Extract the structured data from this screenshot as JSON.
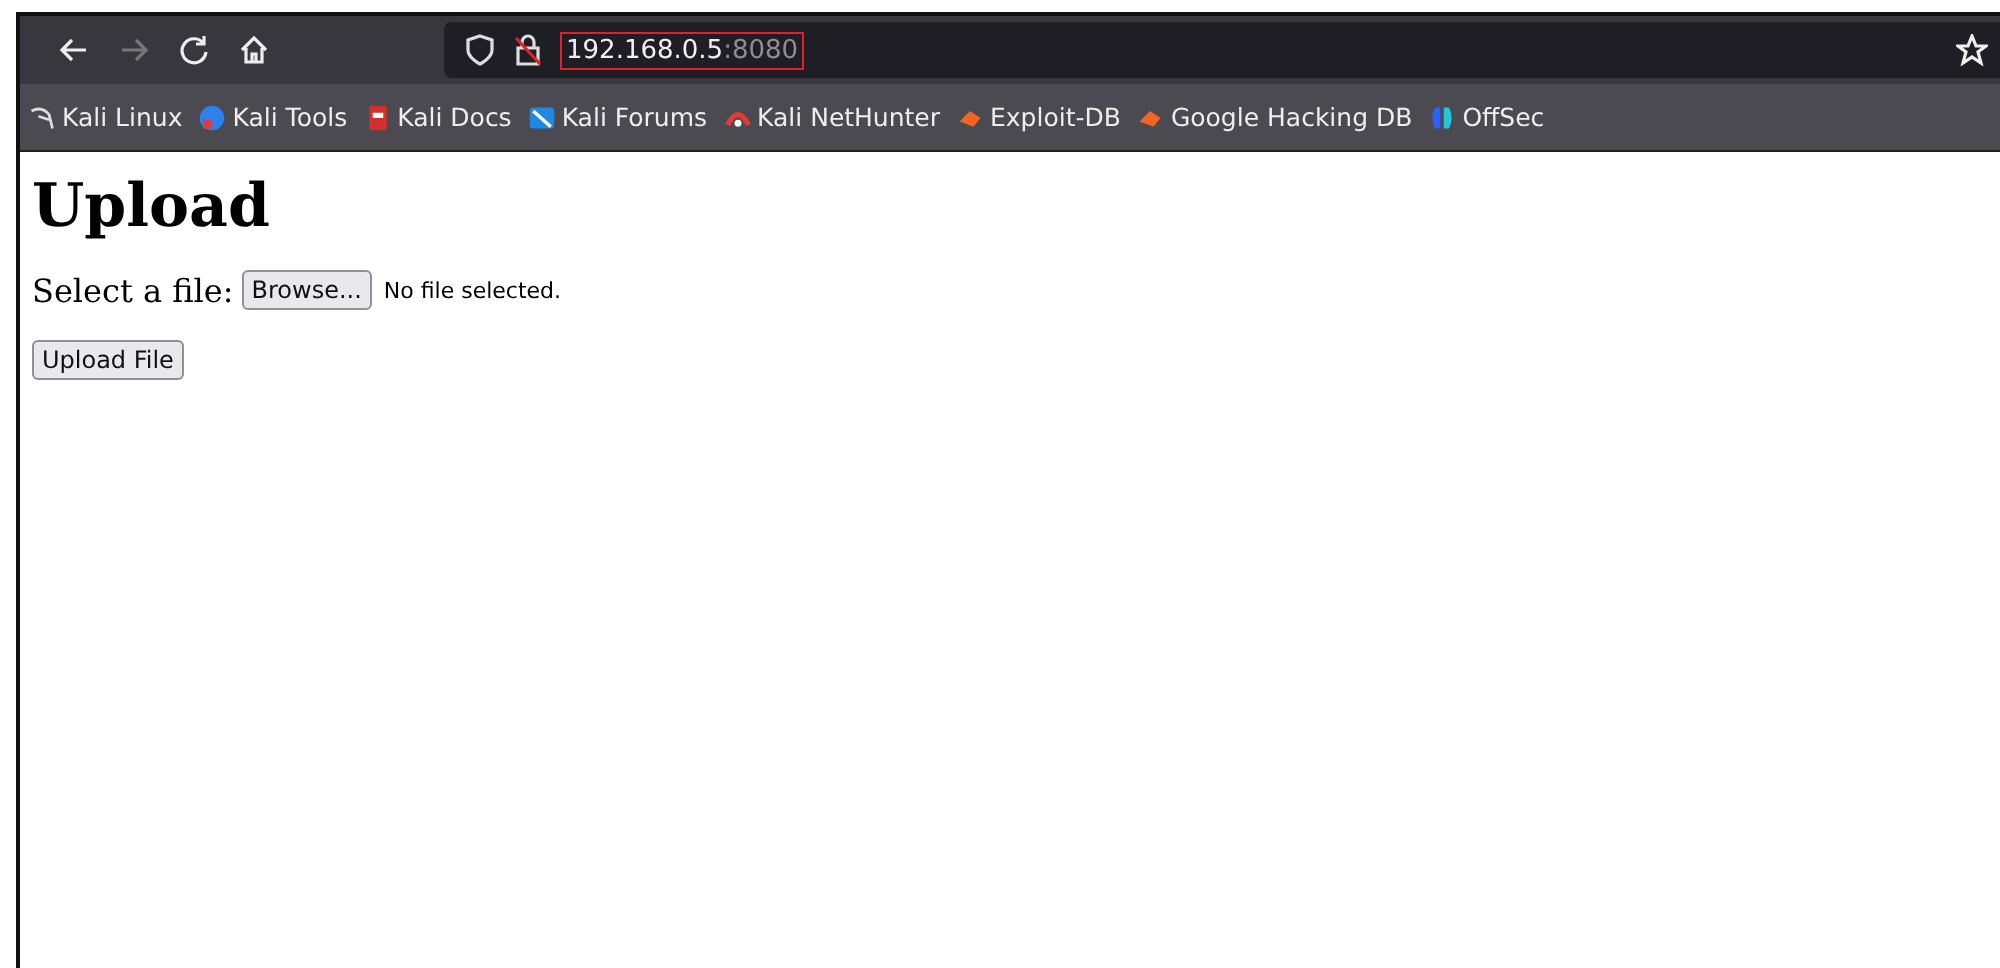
{
  "toolbar": {
    "url_host": "192.168.0.5",
    "url_port": ":8080"
  },
  "bookmarks": [
    {
      "label": "Kali Linux"
    },
    {
      "label": "Kali Tools"
    },
    {
      "label": "Kali Docs"
    },
    {
      "label": "Kali Forums"
    },
    {
      "label": "Kali NetHunter"
    },
    {
      "label": "Exploit-DB"
    },
    {
      "label": "Google Hacking DB"
    },
    {
      "label": "OffSec"
    }
  ],
  "page": {
    "heading": "Upload",
    "file_label": "Select a file:",
    "browse_button": "Browse...",
    "file_status": "No file selected.",
    "submit_button": "Upload File"
  }
}
